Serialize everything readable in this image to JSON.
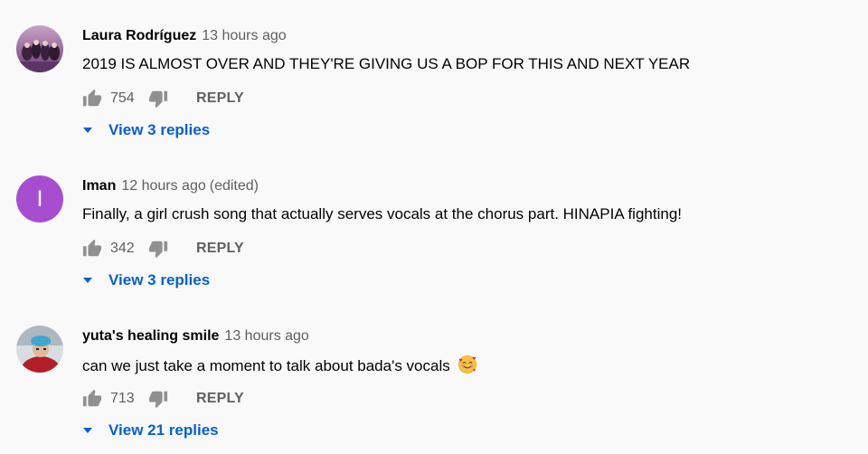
{
  "comments": [
    {
      "author": "Laura Rodríguez",
      "time": "13 hours ago",
      "edited": "",
      "text": "2019 IS ALMOST OVER AND THEY'RE GIVING US A BOP FOR THIS AND NEXT YEAR",
      "likes": "754",
      "reply_label": "REPLY",
      "view_replies": "View 3 replies",
      "avatar": {
        "type": "photo",
        "letter": ""
      }
    },
    {
      "author": "Iman",
      "time": "12 hours ago",
      "edited": "(edited)",
      "text": "Finally, a girl crush song that actually serves vocals at the chorus part. HINAPIA fighting!",
      "likes": "342",
      "reply_label": "REPLY",
      "view_replies": "View 3 replies",
      "avatar": {
        "type": "letter",
        "letter": "I",
        "color": "#a74ed0"
      }
    },
    {
      "author": "yuta's healing smile",
      "time": "13 hours ago",
      "edited": "",
      "text": "can we just take a moment to talk about bada's vocals",
      "emoji": "smiling-face-with-hearts-emoji",
      "likes": "713",
      "reply_label": "REPLY",
      "view_replies": "View 21 replies",
      "avatar": {
        "type": "photo",
        "letter": ""
      }
    }
  ],
  "colors": {
    "background": "#f9f9f9",
    "link_blue": "#065fd4",
    "secondary_text": "#606060",
    "primary_text": "#030303"
  }
}
